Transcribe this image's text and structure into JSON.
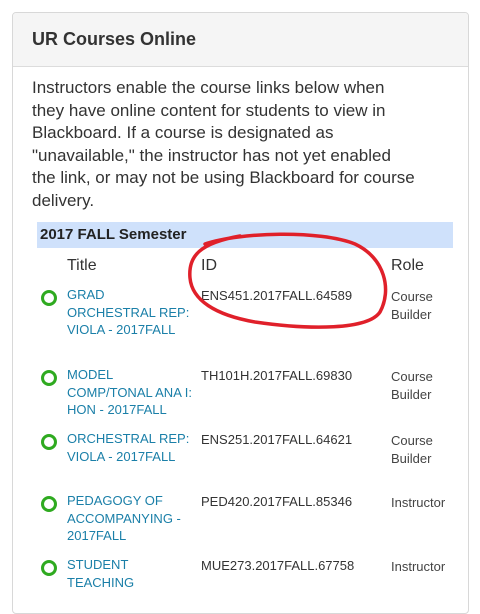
{
  "panel": {
    "title": "UR Courses Online",
    "intro": "Instructors enable the course links below when they have online content for students to view in Blackboard. If a course is designated as \"unavailable,\" the instructor has not yet enabled the link, or may not be using Blackboard for course delivery."
  },
  "semester": {
    "label": "2017 FALL Semester"
  },
  "columns": {
    "title": "Title",
    "id": "ID",
    "role": "Role"
  },
  "courses": [
    {
      "title": "GRAD ORCHESTRAL REP: VIOLA - 2017FALL",
      "id": "ENS451.2017FALL.64589",
      "role": "Course Builder"
    },
    {
      "title": "MODEL COMP/TONAL ANA I: HON - 2017FALL",
      "id": "TH101H.2017FALL.69830",
      "role": "Course Builder"
    },
    {
      "title": "ORCHESTRAL REP: VIOLA - 2017FALL",
      "id": "ENS251.2017FALL.64621",
      "role": "Course Builder"
    },
    {
      "title": "PEDAGOGY OF ACCOMPANYING - 2017FALL",
      "id": "PED420.2017FALL.85346",
      "role": "Instructor"
    },
    {
      "title": "STUDENT TEACHING",
      "id": "MUE273.2017FALL.67758",
      "role": "Instructor"
    }
  ],
  "colors": {
    "status": "#2faa20",
    "link": "#1a7fa8",
    "semester_bg": "#cfe1fb",
    "annotation": "#e0202a"
  },
  "icons": {
    "status": "circle-outline-icon"
  }
}
